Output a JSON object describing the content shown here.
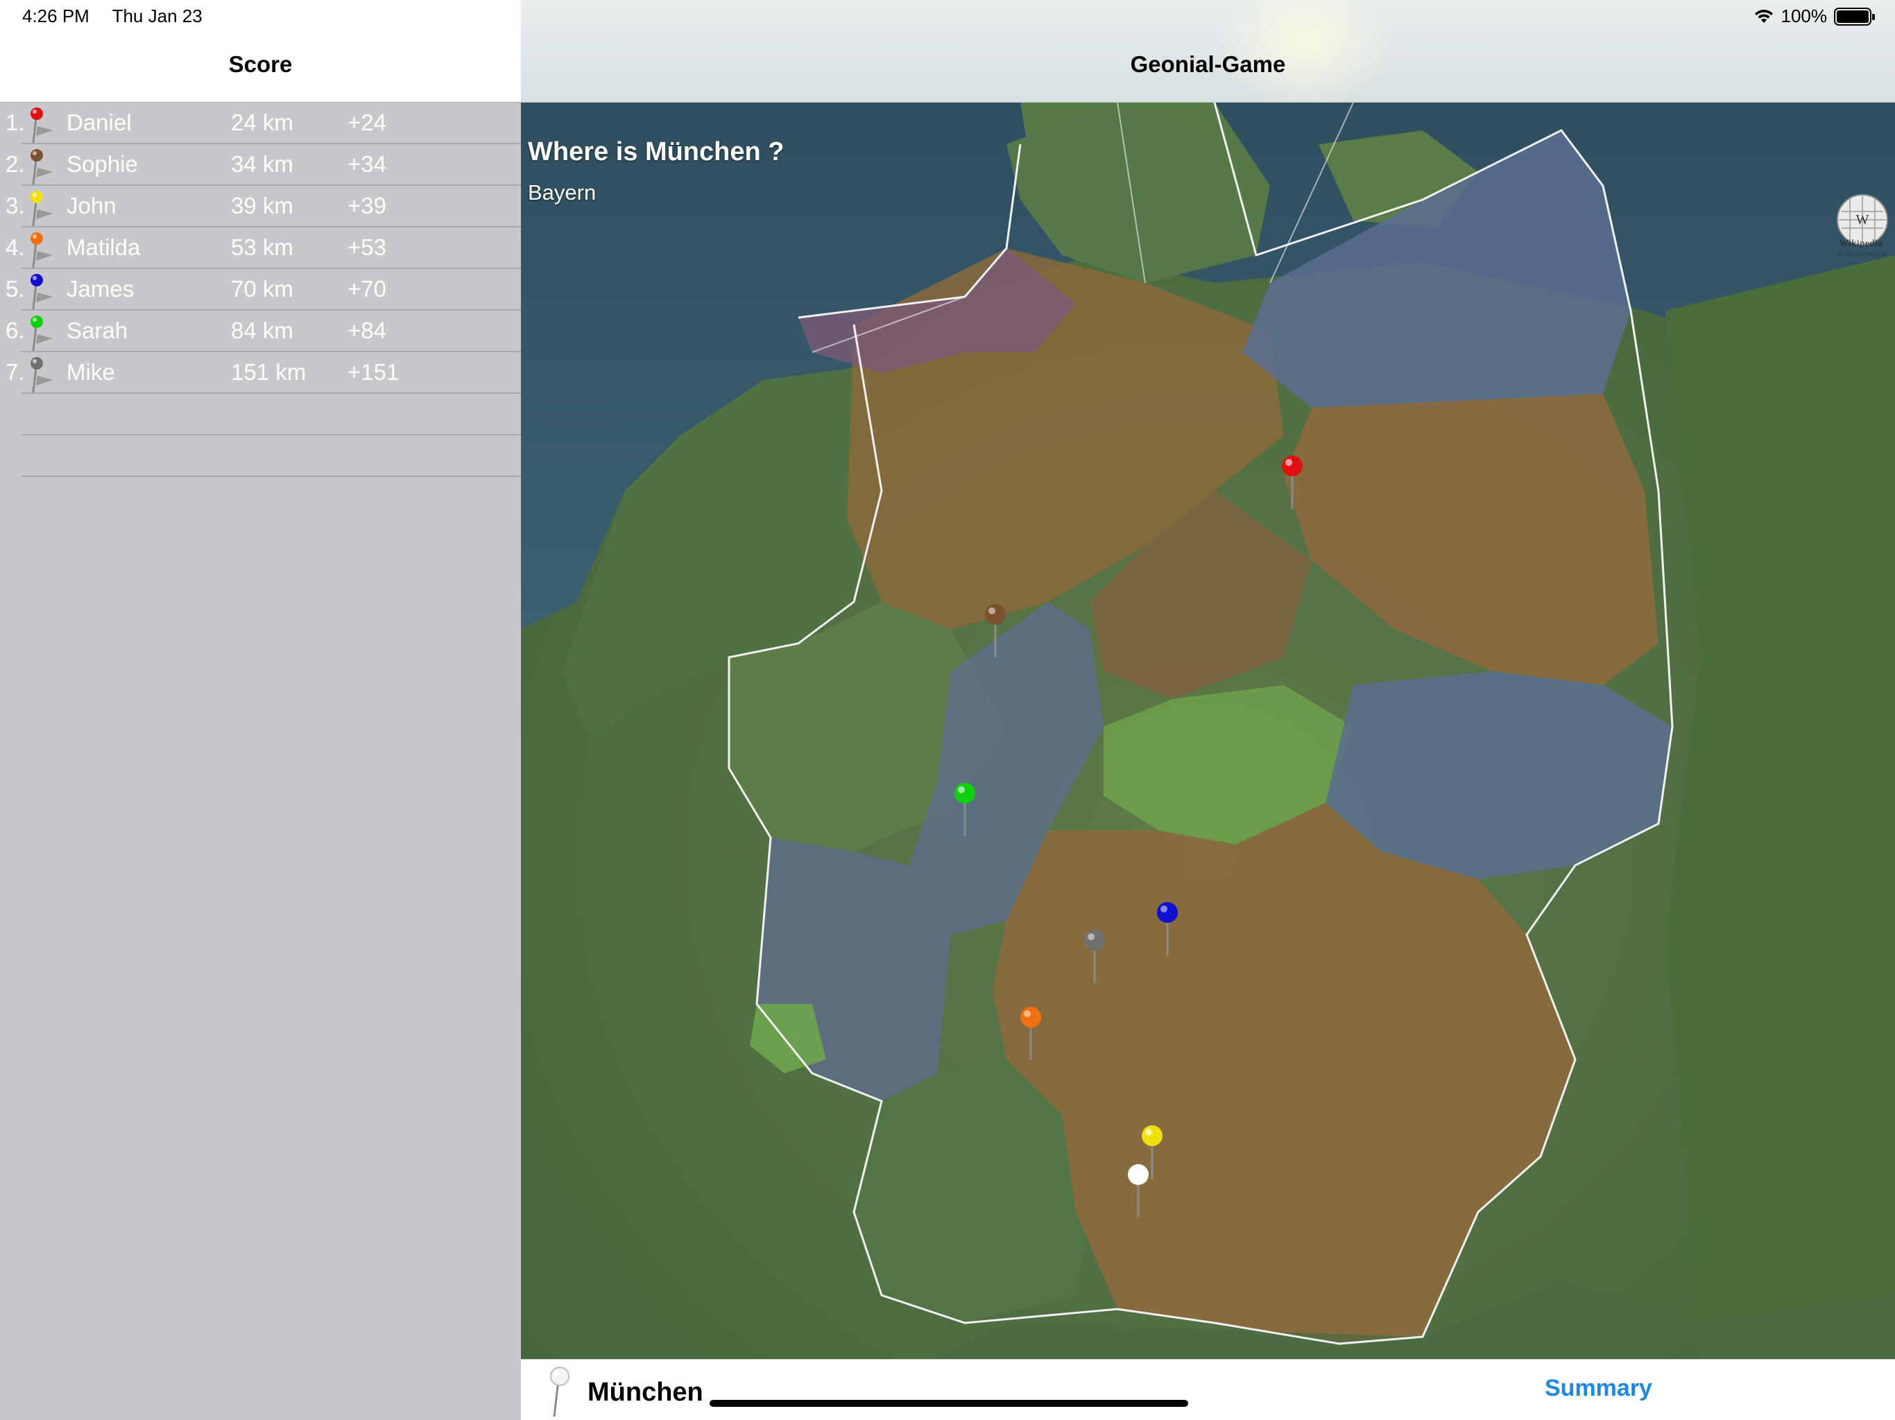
{
  "status_bar": {
    "time": "4:26 PM",
    "date": "Thu Jan 23",
    "battery": "100%",
    "wifi_icon": "wifi-icon",
    "battery_icon": "battery-icon"
  },
  "score_panel": {
    "title": "Score",
    "rows": [
      {
        "rank": "1.",
        "name": "Daniel",
        "distance": "24 km",
        "points": "+24",
        "pin_color": "#e01010"
      },
      {
        "rank": "2.",
        "name": "Sophie",
        "distance": "34 km",
        "points": "+34",
        "pin_color": "#7a5230"
      },
      {
        "rank": "3.",
        "name": "John",
        "distance": "39 km",
        "points": "+39",
        "pin_color": "#f0e010"
      },
      {
        "rank": "4.",
        "name": "Matilda",
        "distance": "53 km",
        "points": "+53",
        "pin_color": "#f07010"
      },
      {
        "rank": "5.",
        "name": "James",
        "distance": "70 km",
        "points": "+70",
        "pin_color": "#1010d0"
      },
      {
        "rank": "6.",
        "name": "Sarah",
        "distance": "84 km",
        "points": "+84",
        "pin_color": "#10d010"
      },
      {
        "rank": "7.",
        "name": "Mike",
        "distance": "151 km",
        "points": "+151",
        "pin_color": "#707070"
      }
    ],
    "empty_rows": 2
  },
  "game": {
    "title": "Geonial-Game",
    "question": "Where is München ?",
    "region": "Bayern",
    "map_attribution": "Wikipedia",
    "map_attribution_tagline": "The Free Encyclopedia",
    "guess_pins": [
      {
        "player": "Daniel",
        "color": "#e01010"
      },
      {
        "player": "Sophie",
        "color": "#7a5230"
      },
      {
        "player": "Sarah",
        "color": "#10d010"
      },
      {
        "player": "James",
        "color": "#1010d0"
      },
      {
        "player": "Mike",
        "color": "#707070"
      },
      {
        "player": "Matilda",
        "color": "#f07010"
      },
      {
        "player": "John",
        "color": "#f0e010"
      }
    ],
    "target_pin_color": "#ffffff"
  },
  "toolbar": {
    "city": "München",
    "summary_label": "Summary",
    "accent": "#1e88e5"
  }
}
